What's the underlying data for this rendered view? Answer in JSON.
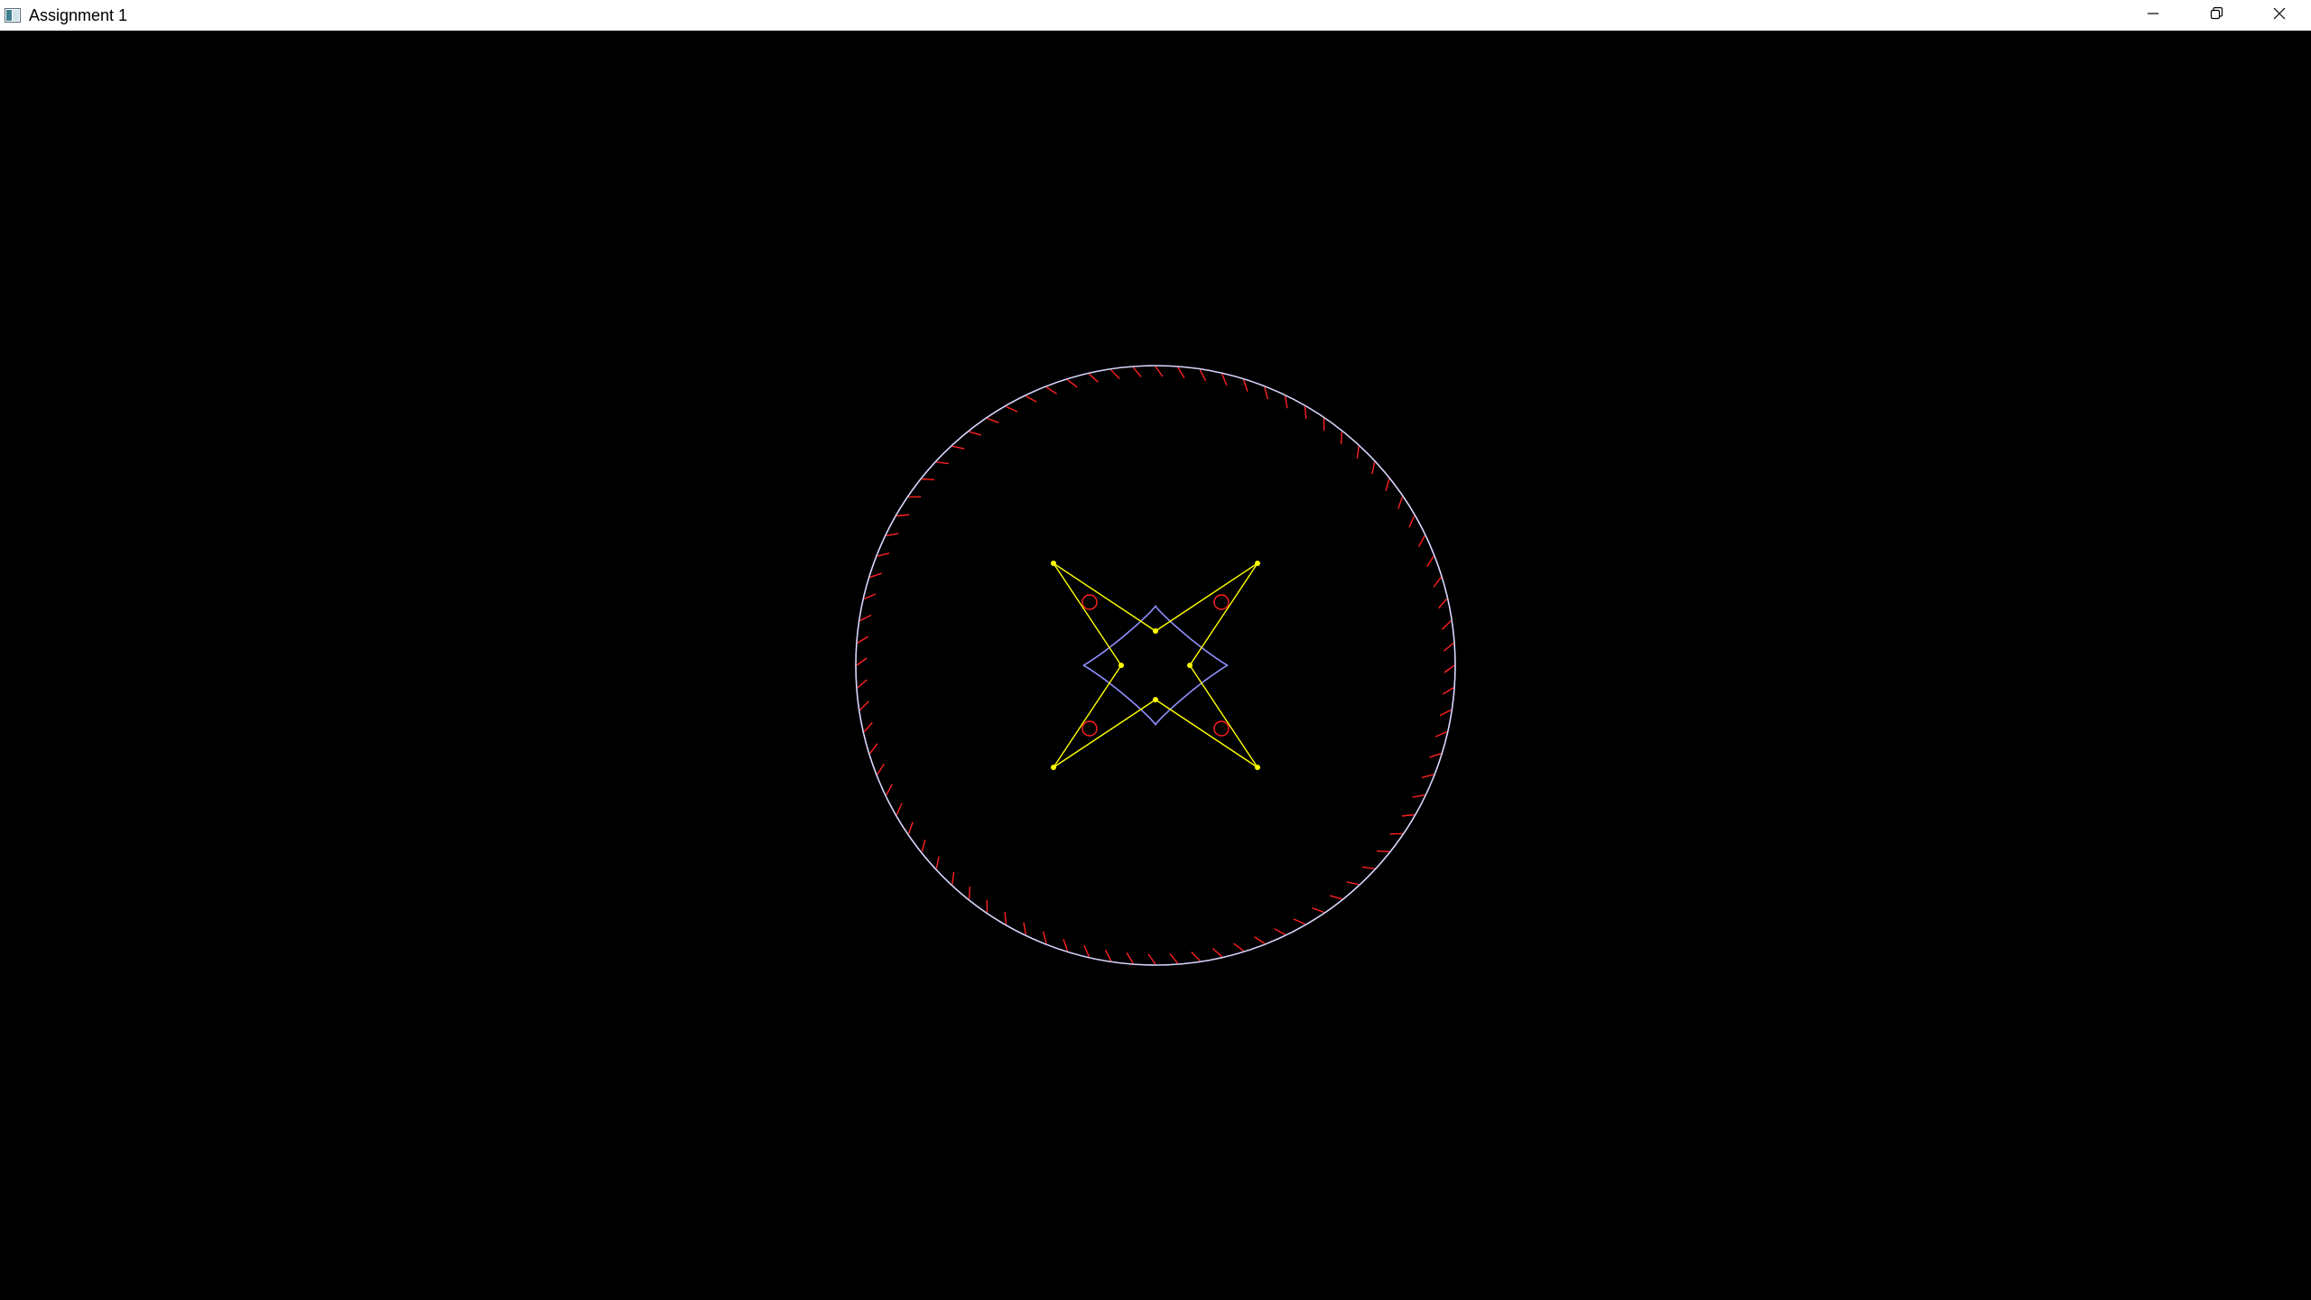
{
  "window": {
    "title": "Assignment 1",
    "app_icon": "window-app-icon",
    "controls": {
      "minimize_icon": "minimize-icon",
      "maximize_icon": "restore-icon",
      "close_icon": "close-icon"
    }
  },
  "scene": {
    "background_color": "#000000",
    "outer_circle": {
      "stroke_color": "#d8d8ff",
      "tick_color": "#ff2020",
      "tick_count": 84
    },
    "astroid": {
      "curve_color": "#9090ff",
      "control_polygon_color": "#ffff00",
      "control_point_color": "#ffff00",
      "loop_color": "#ff2020"
    }
  }
}
